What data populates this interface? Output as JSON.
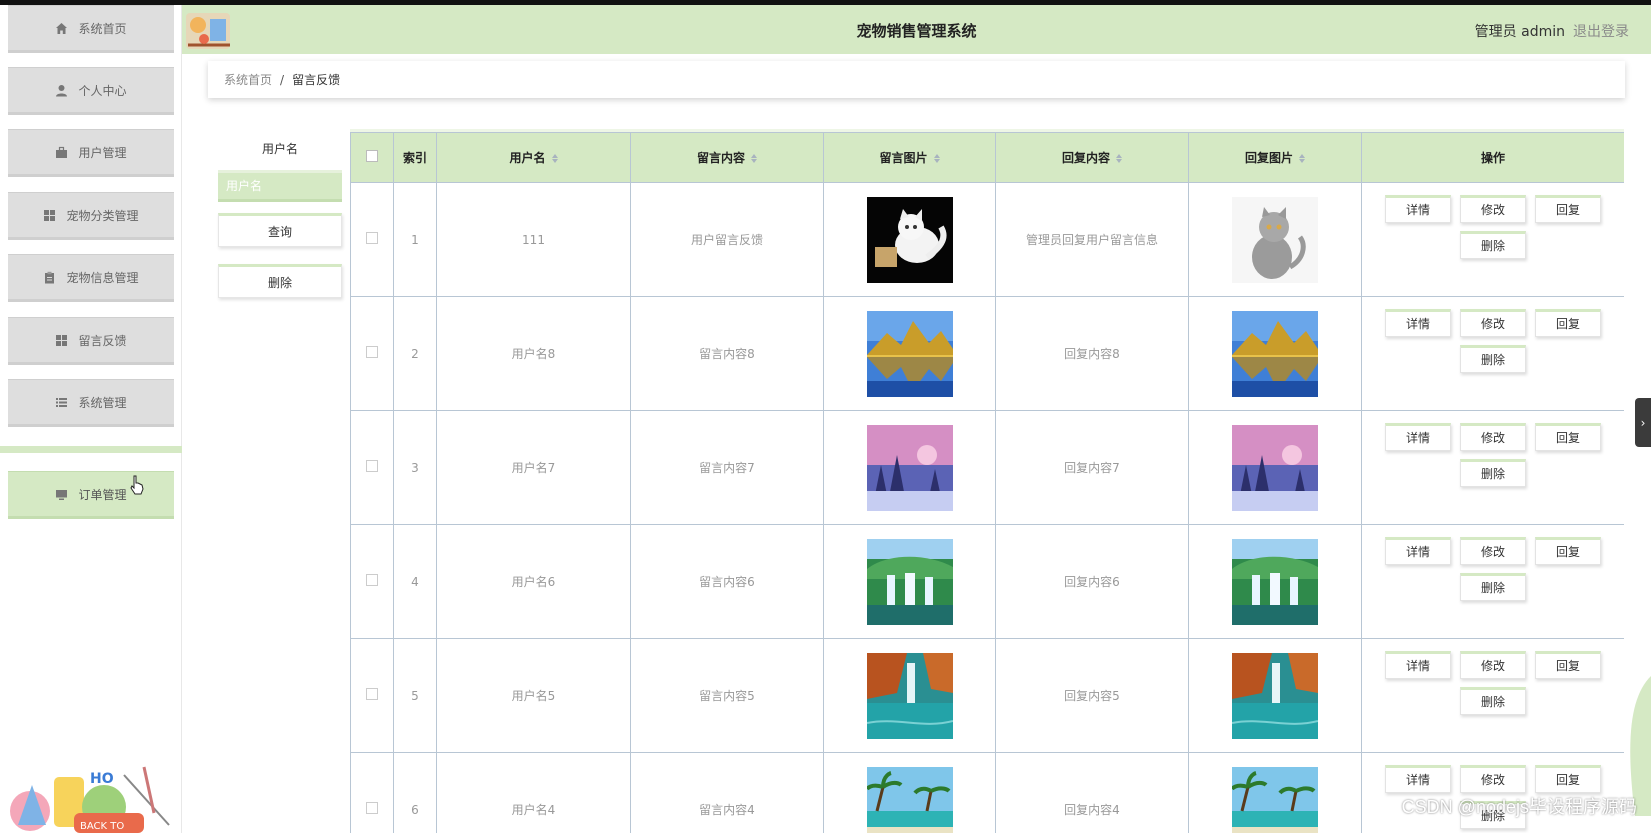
{
  "app": {
    "title": "宠物销售管理系统",
    "user_label": "管理员 admin",
    "logout": "退出登录"
  },
  "sidebar": {
    "items": [
      {
        "label": "系统首页",
        "icon": "home-icon"
      },
      {
        "label": "个人中心",
        "icon": "user-icon"
      },
      {
        "label": "用户管理",
        "icon": "briefcase-icon"
      },
      {
        "label": "宠物分类管理",
        "icon": "grid-icon"
      },
      {
        "label": "宠物信息管理",
        "icon": "clipboard-icon"
      },
      {
        "label": "留言反馈",
        "icon": "grid-icon"
      },
      {
        "label": "系统管理",
        "icon": "list-icon"
      },
      {
        "label": "订单管理",
        "icon": "monitor-icon"
      }
    ],
    "art_text": {
      "ho": "HO",
      "back_to": "BACK TO"
    }
  },
  "breadcrumb": {
    "home": "系统首页",
    "separator": "/",
    "current": "留言反馈"
  },
  "search": {
    "label": "用户名",
    "placeholder": "用户名",
    "query_btn": "查询",
    "delete_btn": "删除"
  },
  "table": {
    "headers": [
      "索引",
      "用户名",
      "留言内容",
      "留言图片",
      "回复内容",
      "回复图片",
      "操作"
    ],
    "rows": [
      {
        "index": "1",
        "username": "111",
        "content": "用户留言反馈",
        "reply": "管理员回复用户留言信息",
        "img": "cat-white",
        "reply_img": "cat-gray"
      },
      {
        "index": "2",
        "username": "用户名8",
        "content": "留言内容8",
        "reply": "回复内容8",
        "img": "mountain-lake",
        "reply_img": "mountain-lake"
      },
      {
        "index": "3",
        "username": "用户名7",
        "content": "留言内容7",
        "reply": "回复内容7",
        "img": "winter-sunset",
        "reply_img": "winter-sunset"
      },
      {
        "index": "4",
        "username": "用户名6",
        "content": "留言内容6",
        "reply": "回复内容6",
        "img": "waterfall",
        "reply_img": "waterfall"
      },
      {
        "index": "5",
        "username": "用户名5",
        "content": "留言内容5",
        "reply": "回复内容5",
        "img": "autumn-waterfall",
        "reply_img": "autumn-waterfall"
      },
      {
        "index": "6",
        "username": "用户名4",
        "content": "留言内容4",
        "reply": "回复内容4",
        "img": "tropical-beach",
        "reply_img": "tropical-beach"
      }
    ],
    "actions": {
      "detail": "详情",
      "edit": "修改",
      "reply": "回复",
      "delete": "删除"
    }
  },
  "right_tab": "›",
  "watermark": "CSDN @nodejs毕设程序源码",
  "colors": {
    "accent": "#d5e9c4",
    "border": "#b8c6d4"
  }
}
